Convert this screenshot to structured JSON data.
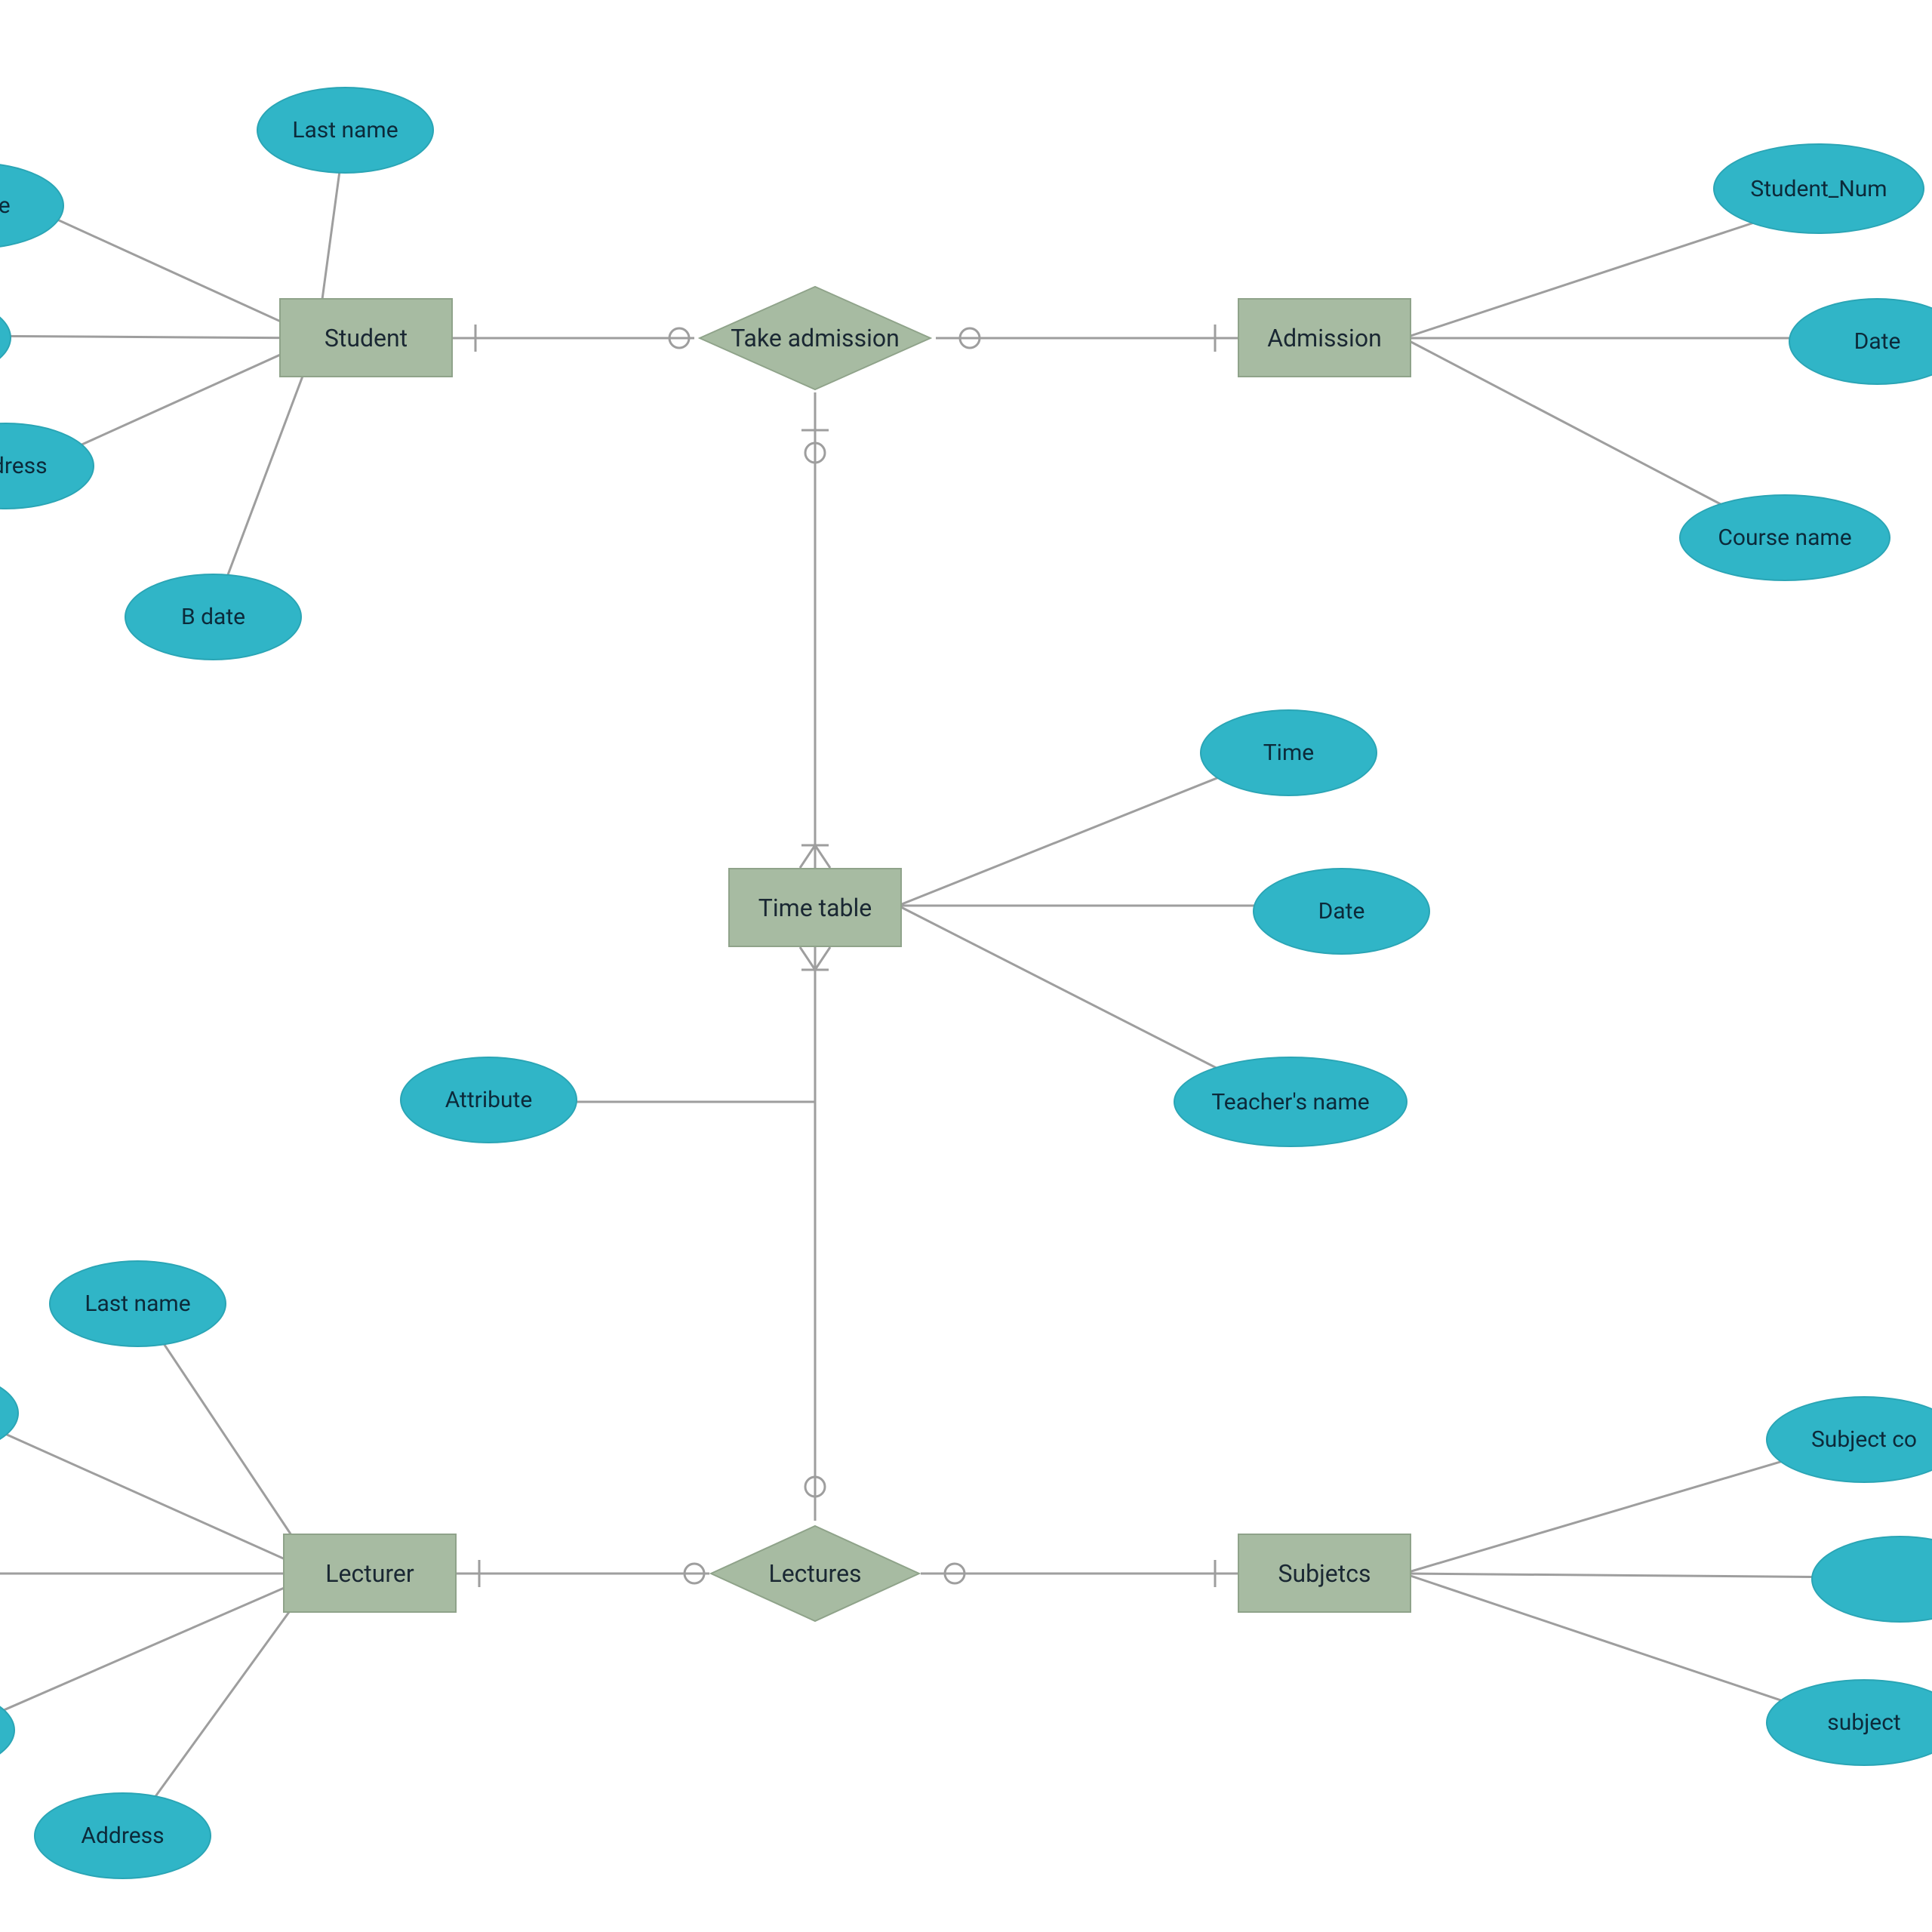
{
  "entities": {
    "student": "Student",
    "admission": "Admission",
    "timetable": "Time table",
    "lecturer": "Lecturer",
    "subjects": "Subjetcs"
  },
  "relationships": {
    "takeAdmission": "Take admission",
    "lectures": "Lectures"
  },
  "attributes": {
    "student_lastname": "Last name",
    "student_firstname": "t name",
    "student_address": "Address",
    "student_bdate": "B date",
    "admission_studentnum": "Student_Num",
    "admission_date": "Date",
    "admission_coursename": "Course name",
    "timetable_time": "Time",
    "timetable_date": "Date",
    "timetable_teachername": "Teacher's name",
    "timetable_attribute": "Attribute",
    "lecturer_lastname": "Last name",
    "lecturer_address": "Address",
    "subject_code": "Subject co",
    "subject_name": "subject "
  },
  "colors": {
    "entity": "#a7bba2",
    "attribute": "#30b5c7",
    "text": "#1a2833",
    "line": "#9e9e9e"
  }
}
